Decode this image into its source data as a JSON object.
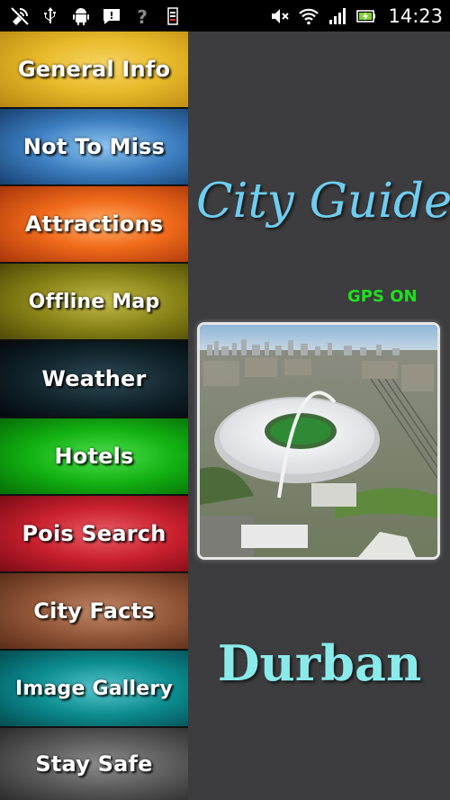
{
  "status_bar": {
    "left_icons": [
      "gps-off-icon",
      "usb-icon",
      "android-debug-icon",
      "message-icon",
      "wifi-question-icon",
      "sim-icon"
    ],
    "right_icons": [
      "mute-icon",
      "wifi-icon",
      "signal-icon",
      "battery-charging-icon"
    ],
    "time": "14:23"
  },
  "menu": {
    "items": [
      {
        "label": "General Info"
      },
      {
        "label": "Not To Miss"
      },
      {
        "label": "Attractions"
      },
      {
        "label": "Offline Map"
      },
      {
        "label": "Weather"
      },
      {
        "label": "Hotels"
      },
      {
        "label": "Pois Search"
      },
      {
        "label": "City Facts"
      },
      {
        "label": "Image Gallery"
      },
      {
        "label": "Stay Safe"
      }
    ]
  },
  "panel": {
    "app_title": "City Guide",
    "gps_status": "GPS ON",
    "city_name": "Durban"
  },
  "colors": {
    "background": "#3d3d3f",
    "title": "#6ecdf0",
    "gps": "#1ee01e",
    "city_name": "#8aeaea"
  }
}
